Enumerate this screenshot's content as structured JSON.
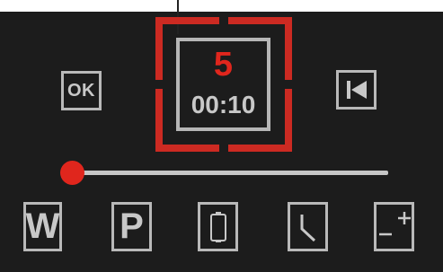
{
  "controls": {
    "ok_label": "OK",
    "previous_icon": "skip-to-start-icon"
  },
  "display": {
    "count": "5",
    "time": "00:10"
  },
  "slider": {
    "value_fraction": 0.0
  },
  "bottom_buttons": {
    "w_label": "W",
    "p_label": "P",
    "phone_icon": "phone-outline-icon",
    "clock_icon": "clock-hand-icon",
    "plus_minus_icon": "plus-minus-icon"
  },
  "colors": {
    "background": "#1c1c1c",
    "accent": "#cc2a22",
    "count": "#e0261d",
    "foreground": "#c8c8c8"
  }
}
